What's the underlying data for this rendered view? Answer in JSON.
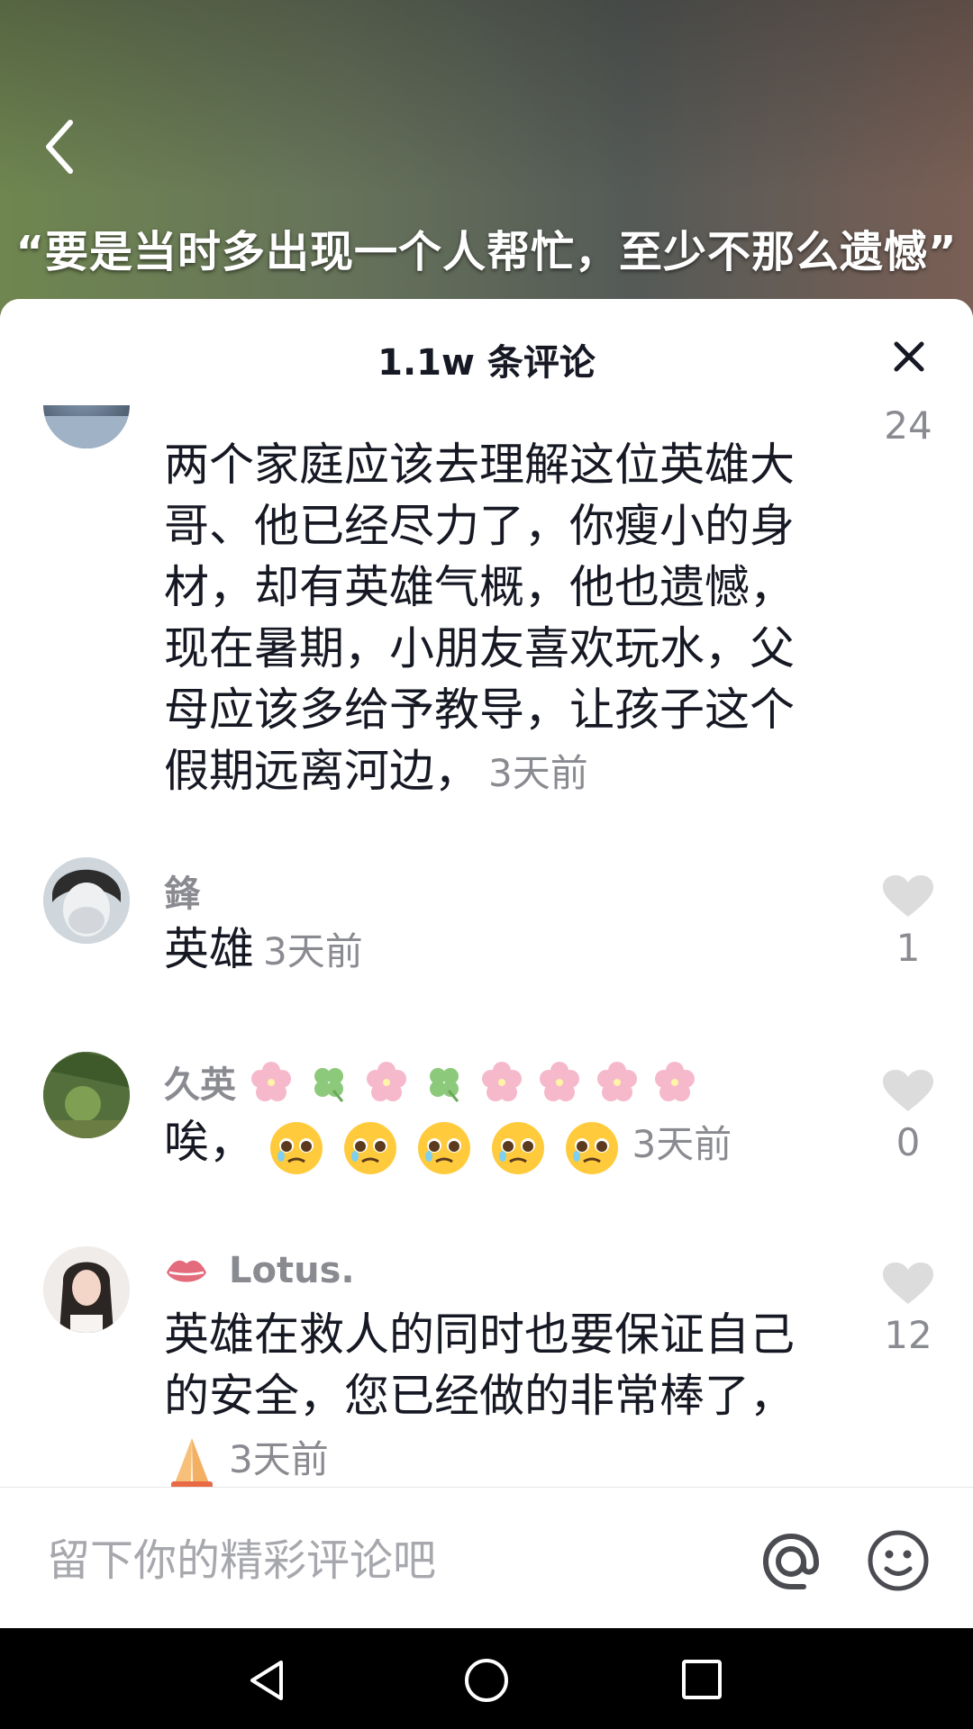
{
  "video": {
    "caption": "“要是当时多出现一个人帮忙，至少不那么遗憾”"
  },
  "sheet": {
    "title": "1.1w 条评论"
  },
  "comments": [
    {
      "username": "",
      "text": "两个家庭应该去理解这位英雄大哥、他已经尽力了，你瘦小的身材，却有英雄气概，他也遗憾，现在暑期，小朋友喜欢玩水，父母应该多给予教导，让孩子这个假期远离河边，",
      "time": "3天前",
      "likes": "24"
    },
    {
      "username": "鋒",
      "text": "英雄",
      "time": "3天前",
      "likes": "1"
    },
    {
      "username": "久英",
      "text": "唉，",
      "emoji_count": 5,
      "time": "3天前",
      "likes": "0"
    },
    {
      "username": "Lotus.",
      "text": "英雄在救人的同时也要保证自己的安全，您已经做的非常棒了，",
      "time": "3天前",
      "likes": "12"
    }
  ],
  "input": {
    "placeholder": "留下你的精彩评论吧"
  },
  "colors": {
    "heart": "#dcdcdc",
    "meta_text": "#8a8b91",
    "body_text": "#161823"
  },
  "icons": [
    "back-arrow-icon",
    "close-icon",
    "heart-icon",
    "at-icon",
    "emoji-icon",
    "nav-back-icon",
    "nav-home-icon",
    "nav-recent-icon",
    "cherry-blossom-icon",
    "clover-icon",
    "lips-icon",
    "pleading-face-icon",
    "praying-hands-icon"
  ]
}
